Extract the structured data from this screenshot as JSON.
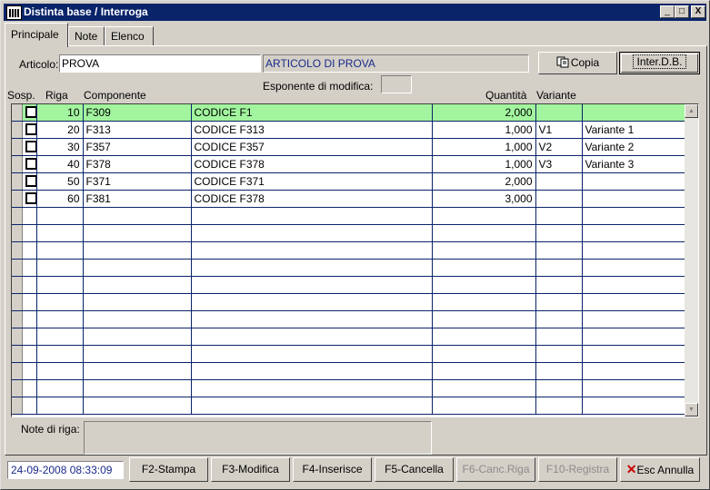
{
  "window": {
    "title": "Distinta base / Interroga",
    "controls": {
      "minimize": "_",
      "maximize": "□",
      "close": "X"
    }
  },
  "tabs": [
    {
      "label": "Principale",
      "active": true
    },
    {
      "label": "Note",
      "active": false
    },
    {
      "label": "Elenco",
      "active": false
    }
  ],
  "form": {
    "articolo_label": "Articolo:",
    "articolo_code": "PROVA",
    "articolo_description": "ARTICOLO DI PROVA",
    "esponente_label": "Esponente di modifica:",
    "esponente_value": ""
  },
  "buttons": {
    "copia": "Copia",
    "interdb": "Inter.D.B."
  },
  "columns": {
    "sosp": "Sosp.",
    "riga": "Riga",
    "componente": "Componente",
    "quantita": "Quantità",
    "variante": "Variante"
  },
  "rows": [
    {
      "riga": "10",
      "componente": "F309",
      "descrizione": "CODICE F1",
      "quantita": "2,000",
      "variante": "",
      "variante_desc": ""
    },
    {
      "riga": "20",
      "componente": "F313",
      "descrizione": "CODICE F313",
      "quantita": "1,000",
      "variante": "V1",
      "variante_desc": "Variante 1"
    },
    {
      "riga": "30",
      "componente": "F357",
      "descrizione": "CODICE F357",
      "quantita": "1,000",
      "variante": "V2",
      "variante_desc": "Variante 2"
    },
    {
      "riga": "40",
      "componente": "F378",
      "descrizione": "CODICE F378",
      "quantita": "1,000",
      "variante": "V3",
      "variante_desc": "Variante 3"
    },
    {
      "riga": "50",
      "componente": "F371",
      "descrizione": "CODICE F371",
      "quantita": "2,000",
      "variante": "",
      "variante_desc": ""
    },
    {
      "riga": "60",
      "componente": "F381",
      "descrizione": "CODICE F378",
      "quantita": "3,000",
      "variante": "",
      "variante_desc": ""
    }
  ],
  "note": {
    "label": "Note di riga:",
    "value": ""
  },
  "status": {
    "datetime": "24-09-2008 08:33:09"
  },
  "footer_buttons": {
    "stampa": "F2-Stampa",
    "modifica": "F3-Modifica",
    "inserisce": "F4-Inserisce",
    "cancella": "F5-Cancella",
    "canc_riga": "F6-Canc.Riga",
    "registra": "F10-Registra",
    "esc": "Esc Annulla"
  },
  "colors": {
    "titlebar": "#0a246a",
    "highlight_row": "#a2f59e",
    "grid_lines": "#0a246a",
    "readonly_text": "#1a2a8a",
    "esc_icon": "#cc0000"
  }
}
